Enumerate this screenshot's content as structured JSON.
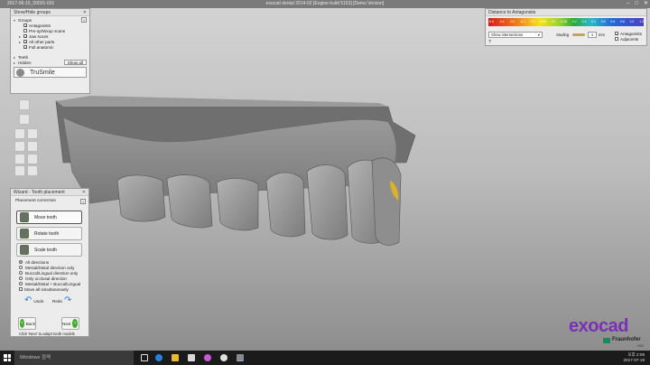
{
  "window": {
    "left_title": "2017-06-15_00001-001",
    "title": "exocad dental 2014-02 [Engine build 5163] [Demo Version]"
  },
  "show_hide": {
    "title": "Show/Hide groups",
    "groups_label": "Groups",
    "items": [
      {
        "label": "Antagonists",
        "checked": true
      },
      {
        "label": "Pre-op/Wxup scans",
        "checked": false
      },
      {
        "label": "Jaw scans",
        "checked": true
      },
      {
        "label": "All other parts",
        "checked": true
      },
      {
        "label": "Full anatomic",
        "checked": true
      }
    ],
    "teeth_label": "Teeth",
    "hidden_label": "Hidden",
    "show_all_label": "Show all",
    "brand_label": "TruSmile"
  },
  "distance": {
    "title": "Distance to Antagonists",
    "scale_top": [
      "-0.6",
      "-0.4",
      "-0.2",
      "-0.1",
      "0.0",
      "0.05",
      "0.1",
      "0.15",
      "0.2",
      "0.3",
      "0.4",
      "0.5",
      "0.6",
      "0.8",
      "1.0",
      "1.2"
    ],
    "dropdown_value": "Show intersections",
    "studing_label": "Studing",
    "studing_value": "1",
    "studing_unit": "mm",
    "antagonists_label": "Antagonists",
    "adjacents_label": "Adjacents"
  },
  "wizard": {
    "title": "Wizard - Tooth placement",
    "section_label": "Placement correction",
    "buttons": [
      "Move tooth",
      "Rotate tooth",
      "Scale tooth"
    ],
    "options": [
      {
        "label": "All directions",
        "selected": true
      },
      {
        "label": "Mesial/Distal direction only",
        "selected": false
      },
      {
        "label": "Buccal/Lingual direction only",
        "selected": false
      },
      {
        "label": "Only occlusal direction",
        "selected": false
      },
      {
        "label": "Mesial/Distal + Buccal/Lingual",
        "selected": false
      }
    ],
    "move_all_label": "Move all simultaneously",
    "undo_label": "Undo",
    "redo_label": "Redo",
    "back_label": "Back",
    "next_label": "Next",
    "hint": "Click 'Next' to adapt tooth models"
  },
  "logo": {
    "name": "exocad",
    "partner": "Fraunhofer",
    "partner_sub": "IGD"
  },
  "taskbar": {
    "search_placeholder": "Windows 검색",
    "time": "오후 2:06",
    "date": "2017-07-18"
  }
}
